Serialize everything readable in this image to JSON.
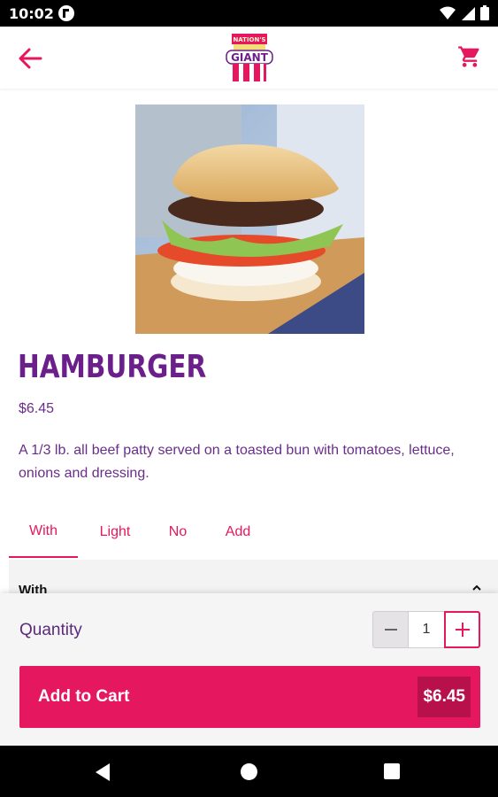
{
  "status_bar": {
    "time": "10:02"
  },
  "header": {
    "back_icon": "arrow-left-icon",
    "cart_icon": "shopping-cart-icon",
    "logo_top_text": "NATION'S",
    "logo_main_text": "GIANT",
    "brand_color": "#e5175f"
  },
  "product": {
    "title": "HAMBURGER",
    "price": "$6.45",
    "description": "A 1/3 lb. all beef patty served on a toasted bun with tomatoes, lettuce, onions and dressing.",
    "title_color": "#6a1f8a"
  },
  "tabs": [
    {
      "label": "With",
      "active": true
    },
    {
      "label": "Light",
      "active": false
    },
    {
      "label": "No",
      "active": false
    },
    {
      "label": "Add",
      "active": false
    }
  ],
  "section": {
    "label": "With",
    "chevron_icon": "chevron-up-icon"
  },
  "quantity": {
    "label": "Quantity",
    "value": "1"
  },
  "add_to_cart": {
    "label": "Add to Cart",
    "price": "$6.45"
  },
  "nav": {
    "back_icon": "nav-back-icon",
    "home_icon": "nav-home-icon",
    "recents_icon": "nav-recents-icon"
  }
}
